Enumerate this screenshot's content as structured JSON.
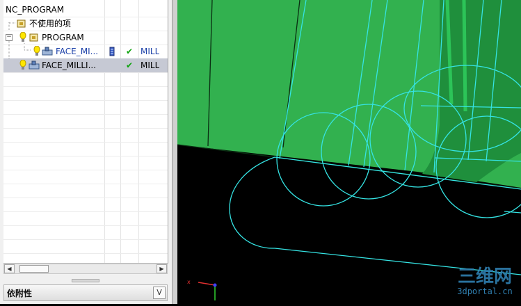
{
  "tree": {
    "rows": [
      {
        "name": "NC_PROGRAM"
      },
      {
        "name": "不使用的项"
      },
      {
        "name": "PROGRAM",
        "expander": "−"
      },
      {
        "name": "FACE_MI...",
        "path_icon": "toolpath-icon",
        "status": "✔",
        "type": "MILL"
      },
      {
        "name": "FACE_MILLI...",
        "status": "✔",
        "type": "MILL"
      }
    ]
  },
  "scrollbar": {
    "left_arrow": "◀",
    "right_arrow": "▶"
  },
  "dependencies": {
    "title": "依附性",
    "toggle": "V"
  },
  "colors": {
    "part_green": "#32b14f",
    "toolpath_cyan": "#35e3e3",
    "check_green": "#0ca30c",
    "selection_gray": "#c6c9d4"
  },
  "icons": {
    "bulb": "lightbulb-icon",
    "program_group": "program-group-icon",
    "operation": "face-mill-operation-icon",
    "check": "checkmark-icon",
    "triad": "coordinate-triad-icon"
  },
  "watermark": {
    "title": "三维网",
    "subtitle": "3dportal.cn"
  }
}
